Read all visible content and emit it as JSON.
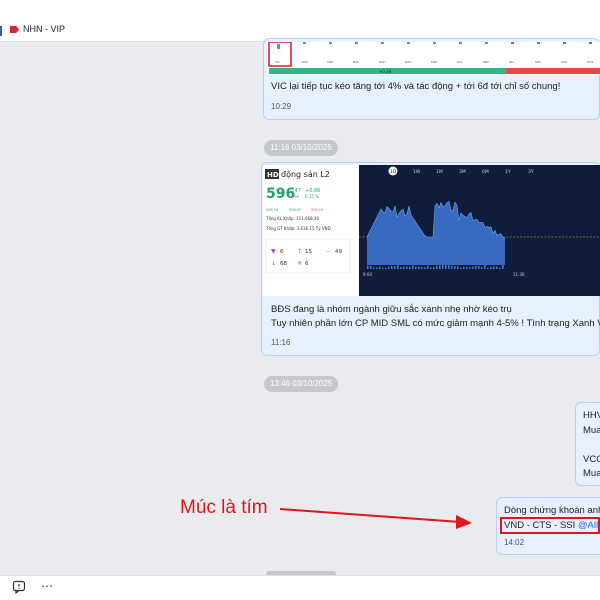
{
  "header": {
    "title": "NHN - VIP"
  },
  "messages": [
    {
      "text": "VIC lại tiếp tục kéo tăng tới 4% và tác động + tới 6đ tới chỉ số chung!",
      "time": "10:29",
      "image": {
        "strip_label": "+0,38",
        "tick_labels": [
          "VIC",
          "VHM",
          "VRE",
          "NVL",
          "KDH",
          "DXG",
          "PDR",
          "DIG",
          "KBC",
          "IDC",
          "SZC",
          "CEO",
          "DXS"
        ]
      }
    },
    {
      "date": "11:16 03/10/2025",
      "image": {
        "logo": "HD",
        "title": "động sản L2",
        "index": "596",
        "index_dec": ".47",
        "change": "+0,86",
        "change_pct": "0.15 %",
        "pts": "PMI",
        "mini_stats": [
          "595.34",
          "596.92",
          "594.19"
        ],
        "vol_label": "Tổng KL Khớp: 111,668.30",
        "val_label": "Tổng GT Khớp: 3,636.15 Tỷ VND",
        "counts": {
          "ceil": "6",
          "up": "15",
          "ref": "49",
          "down": "68",
          "floor": "6"
        },
        "tabs": [
          "1D",
          "1W",
          "1M",
          "3M",
          "6M",
          "1Y",
          "3Y"
        ],
        "x_ticks": [
          "9:00",
          "11:30"
        ]
      },
      "text_lines": [
        "BĐS đang là nhóm ngành giữu sắc xanh nhẹ nhờ kéo trụ",
        "Tuy nhiên phần lớn CP MID SML có mức giảm mạnh 4-5% ! Tình trạng Xanh Vỏ"
      ],
      "time": "11:16"
    },
    {
      "date": "13:46 03/10/2025",
      "outgoing_lines": [
        "HHV",
        "Mua",
        "VCG",
        "Mua"
      ]
    },
    {
      "lines": [
        "Dòng chứng khoán anh",
        "VND - CTS - SSI"
      ],
      "mention": "@All",
      "time": "14:02"
    }
  ],
  "annotation": {
    "text": "Múc là tím"
  }
}
